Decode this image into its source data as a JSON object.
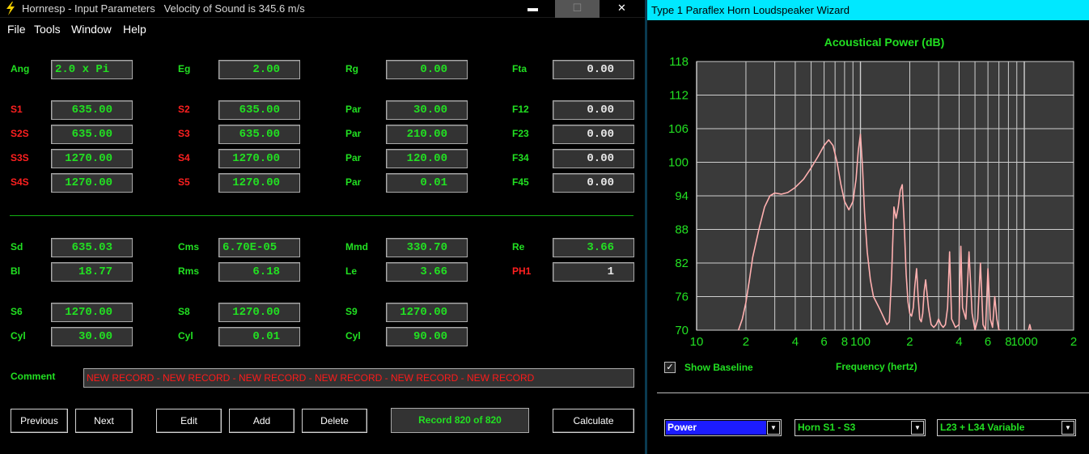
{
  "left_window": {
    "title": "Hornresp - Input Parameters   Velocity of Sound is 345.6 m/s",
    "controls": {
      "min": "▬",
      "max": "☐",
      "close": "✕"
    },
    "menu": [
      "File",
      "Tools",
      "Window",
      "Help"
    ],
    "params": {
      "ang": {
        "label": "Ang",
        "value": "2.0 x Pi"
      },
      "eg": {
        "label": "Eg",
        "value": "2.00"
      },
      "rg": {
        "label": "Rg",
        "value": "0.00"
      },
      "fta": {
        "label": "Fta",
        "value": "0.00"
      },
      "s1": {
        "label": "S1",
        "value": "635.00"
      },
      "s2": {
        "label": "S2",
        "value": "635.00"
      },
      "par1": {
        "label": "Par",
        "value": "30.00"
      },
      "f12": {
        "label": "F12",
        "value": "0.00"
      },
      "s2s": {
        "label": "S2S",
        "value": "635.00"
      },
      "s3": {
        "label": "S3",
        "value": "635.00"
      },
      "par2": {
        "label": "Par",
        "value": "210.00"
      },
      "f23": {
        "label": "F23",
        "value": "0.00"
      },
      "s3s": {
        "label": "S3S",
        "value": "1270.00"
      },
      "s4": {
        "label": "S4",
        "value": "1270.00"
      },
      "par3": {
        "label": "Par",
        "value": "120.00"
      },
      "f34": {
        "label": "F34",
        "value": "0.00"
      },
      "s4s": {
        "label": "S4S",
        "value": "1270.00"
      },
      "s5": {
        "label": "S5",
        "value": "1270.00"
      },
      "par4": {
        "label": "Par",
        "value": "0.01"
      },
      "f45": {
        "label": "F45",
        "value": "0.00"
      },
      "sd": {
        "label": "Sd",
        "value": "635.03"
      },
      "cms": {
        "label": "Cms",
        "value": "6.70E-05"
      },
      "mmd": {
        "label": "Mmd",
        "value": "330.70"
      },
      "re": {
        "label": "Re",
        "value": "3.66"
      },
      "bl": {
        "label": "Bl",
        "value": "18.77"
      },
      "rms": {
        "label": "Rms",
        "value": "6.18"
      },
      "le": {
        "label": "Le",
        "value": "3.66"
      },
      "ph1": {
        "label": "PH1",
        "value": "1"
      },
      "s6": {
        "label": "S6",
        "value": "1270.00"
      },
      "s8": {
        "label": "S8",
        "value": "1270.00"
      },
      "s9": {
        "label": "S9",
        "value": "1270.00"
      },
      "cyl1": {
        "label": "Cyl",
        "value": "30.00"
      },
      "cyl2": {
        "label": "Cyl",
        "value": "0.01"
      },
      "cyl3": {
        "label": "Cyl",
        "value": "90.00"
      }
    },
    "comment_label": "Comment",
    "comment_value": "NEW RECORD - NEW RECORD - NEW RECORD - NEW RECORD - NEW RECORD - NEW RECORD",
    "buttons": {
      "previous": "Previous",
      "next": "Next",
      "edit": "Edit",
      "add": "Add",
      "delete": "Delete",
      "calculate": "Calculate"
    },
    "record_status": "Record 820 of 820"
  },
  "right_window": {
    "title": "Type 1 Paraflex Horn Loudspeaker Wizard",
    "show_baseline_label": "Show Baseline",
    "show_baseline_checked": true,
    "selects": {
      "mode": "Power",
      "horn": "Horn S1 - S3",
      "variable": "L23 + L34 Variable"
    }
  },
  "colors": {
    "label_green": "#22e022",
    "label_red": "#ff2020",
    "curve": "#ffb0b0",
    "plot_bg": "#3a3a3a",
    "title_cyan": "#00e8ff"
  },
  "chart_data": {
    "type": "line",
    "title": "Acoustical Power (dB)",
    "xlabel": "Frequency (hertz)",
    "ylabel": "",
    "x_scale": "log",
    "xlim": [
      10,
      2000
    ],
    "ylim": [
      70,
      118
    ],
    "y_ticks": [
      118,
      112,
      106,
      100,
      94,
      88,
      82,
      76,
      70
    ],
    "x_tick_labels": [
      "10",
      "2",
      "4",
      "6",
      "8",
      "100",
      "2",
      "4",
      "6",
      "8",
      "1000",
      "2"
    ],
    "x_tick_values": [
      10,
      20,
      40,
      60,
      80,
      100,
      200,
      400,
      600,
      800,
      1000,
      2000
    ],
    "grid": true,
    "series": [
      {
        "x": [
          18,
          19,
          20,
          21,
          22,
          24,
          26,
          28,
          30,
          33,
          36,
          40,
          45,
          50,
          55,
          60,
          64,
          68,
          72,
          76,
          80,
          85,
          90,
          94,
          97,
          100,
          103,
          106,
          110,
          115,
          120,
          125,
          130,
          135,
          140,
          145,
          150,
          155,
          160,
          165,
          170,
          175,
          180,
          185,
          190,
          195,
          200,
          205,
          210,
          215,
          220,
          225,
          230,
          235,
          240,
          245,
          250,
          260,
          270,
          280,
          290,
          300,
          310,
          320,
          330,
          340,
          350,
          360,
          380,
          400,
          410,
          420,
          440,
          460,
          480,
          500,
          520,
          540,
          560,
          580,
          600,
          620,
          640,
          660,
          680,
          700,
          720
        ],
        "y": [
          70,
          72,
          75,
          79,
          83,
          88,
          92,
          94,
          94.5,
          94.3,
          94.6,
          95.5,
          97,
          99,
          101,
          103,
          104,
          103,
          100,
          96,
          93,
          91.5,
          93,
          97,
          102,
          105,
          99,
          91,
          84,
          79,
          76,
          75,
          74,
          73,
          72,
          71,
          71.5,
          80,
          92,
          90,
          92,
          95,
          96,
          89,
          80,
          75,
          73,
          72.5,
          74,
          78,
          81,
          76,
          72,
          71.5,
          73,
          77,
          79,
          74,
          71,
          70.5,
          71,
          72,
          71,
          70.5,
          71,
          74,
          84,
          72,
          70.5,
          71,
          85,
          74,
          72,
          84,
          73,
          70,
          72,
          82,
          71,
          70,
          81,
          72,
          70.5,
          76,
          72,
          70,
          70
        ]
      },
      {
        "x": [
          1060,
          1080,
          1100
        ],
        "y": [
          70,
          71,
          70
        ]
      }
    ]
  }
}
